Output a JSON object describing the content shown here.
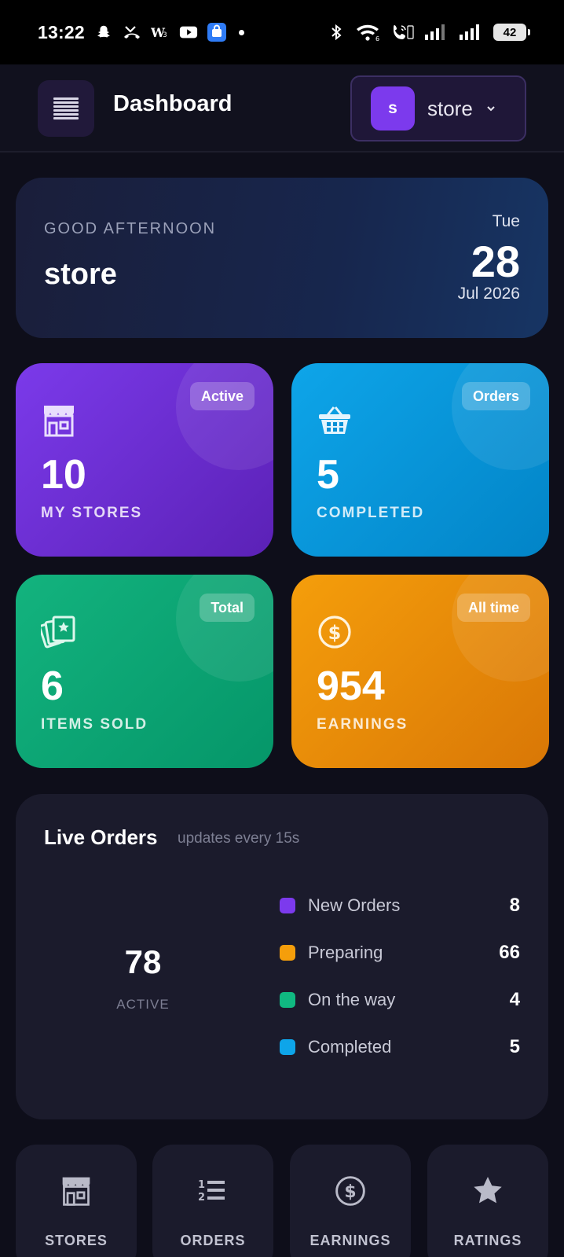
{
  "status_bar": {
    "time": "13:22",
    "battery": "42",
    "left_icons": [
      "snapchat-icon",
      "missed-call-icon",
      "w3-icon",
      "youtube-icon",
      "app-store-icon",
      "dot-icon"
    ],
    "right_icons": [
      "bluetooth-icon",
      "wifi-icon",
      "volte-call-icon",
      "signal-icon",
      "signal-icon"
    ]
  },
  "header": {
    "title": "Dashboard",
    "store_avatar_letter": "s",
    "store_name": "store"
  },
  "greeting": {
    "label": "GOOD AFTERNOON",
    "name": "store",
    "day": "Tue",
    "date": "28",
    "month_year": "Jul 2026"
  },
  "stats": [
    {
      "badge": "Active",
      "value": "10",
      "label": "MY STORES",
      "icon": "store-icon",
      "color": "#7c3aed"
    },
    {
      "badge": "Orders",
      "value": "5",
      "label": "COMPLETED",
      "icon": "basket-icon",
      "color": "#0ea5e9"
    },
    {
      "badge": "Total",
      "value": "6",
      "label": "ITEMS SOLD",
      "icon": "cards-icon",
      "color": "#10b981"
    },
    {
      "badge": "All time",
      "value": "954",
      "label": "EARNINGS",
      "icon": "dollar-icon",
      "color": "#f59e0b"
    }
  ],
  "live_orders": {
    "title": "Live Orders",
    "subtitle": "updates every 15s",
    "total": "78",
    "total_label": "ACTIVE",
    "items": [
      {
        "name": "New Orders",
        "value": "8",
        "color": "#7c3aed"
      },
      {
        "name": "Preparing",
        "value": "66",
        "color": "#f59e0b"
      },
      {
        "name": "On the way",
        "value": "4",
        "color": "#10b981"
      },
      {
        "name": "Completed",
        "value": "5",
        "color": "#0ea5e9"
      }
    ]
  },
  "quick_nav": [
    {
      "label": "STORES",
      "icon": "store-icon"
    },
    {
      "label": "ORDERS",
      "icon": "ordered-list-icon"
    },
    {
      "label": "EARNINGS",
      "icon": "dollar-icon"
    },
    {
      "label": "RATINGS",
      "icon": "star-icon"
    }
  ]
}
